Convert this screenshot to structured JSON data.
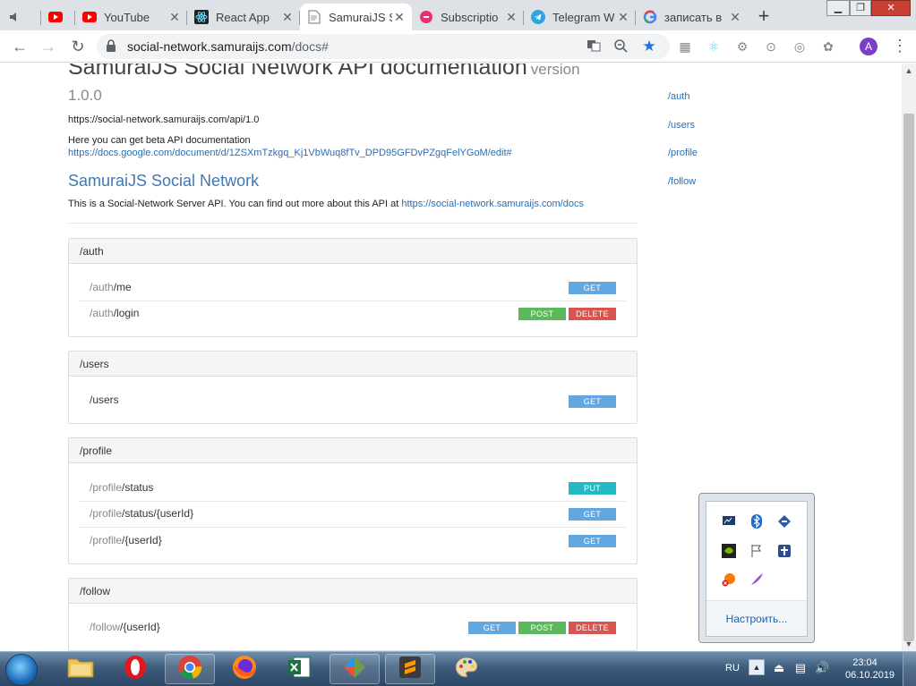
{
  "browser": {
    "tabs": [
      {
        "title": ""
      },
      {
        "title": ""
      },
      {
        "title": "YouTube"
      },
      {
        "title": "React App"
      },
      {
        "title": "SamuraiJS S"
      },
      {
        "title": "Subscriptio"
      },
      {
        "title": "Telegram W"
      },
      {
        "title": "записать в"
      }
    ],
    "url_host": "social-network.samuraijs.com",
    "url_path": "/docs#",
    "profile_initial": "A"
  },
  "page": {
    "title": "SamuraiJS Social Network API documentation",
    "version_word": "version",
    "version": "1.0.0",
    "base_url": "https://social-network.samuraijs.com/api/1.0",
    "beta_text": "Here you can get beta API documentation",
    "beta_link": "https://docs.google.com/document/d/1ZSXmTzkgq_Kj1VbWuq8fTv_DPD95GFDvPZgqFelYGoM/edit#",
    "api_name": "SamuraiJS Social Network",
    "api_desc": "This is a Social-Network Server API. You can find out more about this API at",
    "api_desc_link": "https://social-network.samuraijs.com/docs",
    "sections": [
      {
        "name": "/auth",
        "routes": [
          {
            "prefix": "/auth",
            "path": "/me",
            "methods": [
              "GET"
            ]
          },
          {
            "prefix": "/auth",
            "path": "/login",
            "methods": [
              "POST",
              "DELETE"
            ]
          }
        ]
      },
      {
        "name": "/users",
        "routes": [
          {
            "prefix": "",
            "path": "/users",
            "methods": [
              "GET"
            ]
          }
        ]
      },
      {
        "name": "/profile",
        "routes": [
          {
            "prefix": "/profile",
            "path": "/status",
            "methods": [
              "PUT"
            ]
          },
          {
            "prefix": "/profile",
            "path": "/status/{userId}",
            "methods": [
              "GET"
            ]
          },
          {
            "prefix": "/profile",
            "path": "/{userId}",
            "methods": [
              "GET"
            ]
          }
        ]
      },
      {
        "name": "/follow",
        "routes": [
          {
            "prefix": "/follow",
            "path": "/{userId}",
            "methods": [
              "GET",
              "POST",
              "DELETE"
            ]
          }
        ]
      }
    ],
    "sidenav": [
      "/auth",
      "/users",
      "/profile",
      "/follow"
    ]
  },
  "tray_popup": {
    "customize_label": "Настроить..."
  },
  "taskbar": {
    "language": "RU",
    "time": "23:04",
    "date": "06.10.2019"
  },
  "colors": {
    "get": "#63a7e0",
    "post": "#5cb85c",
    "delete": "#d9534f",
    "put": "#25b9c4",
    "link": "#2a6db5"
  }
}
